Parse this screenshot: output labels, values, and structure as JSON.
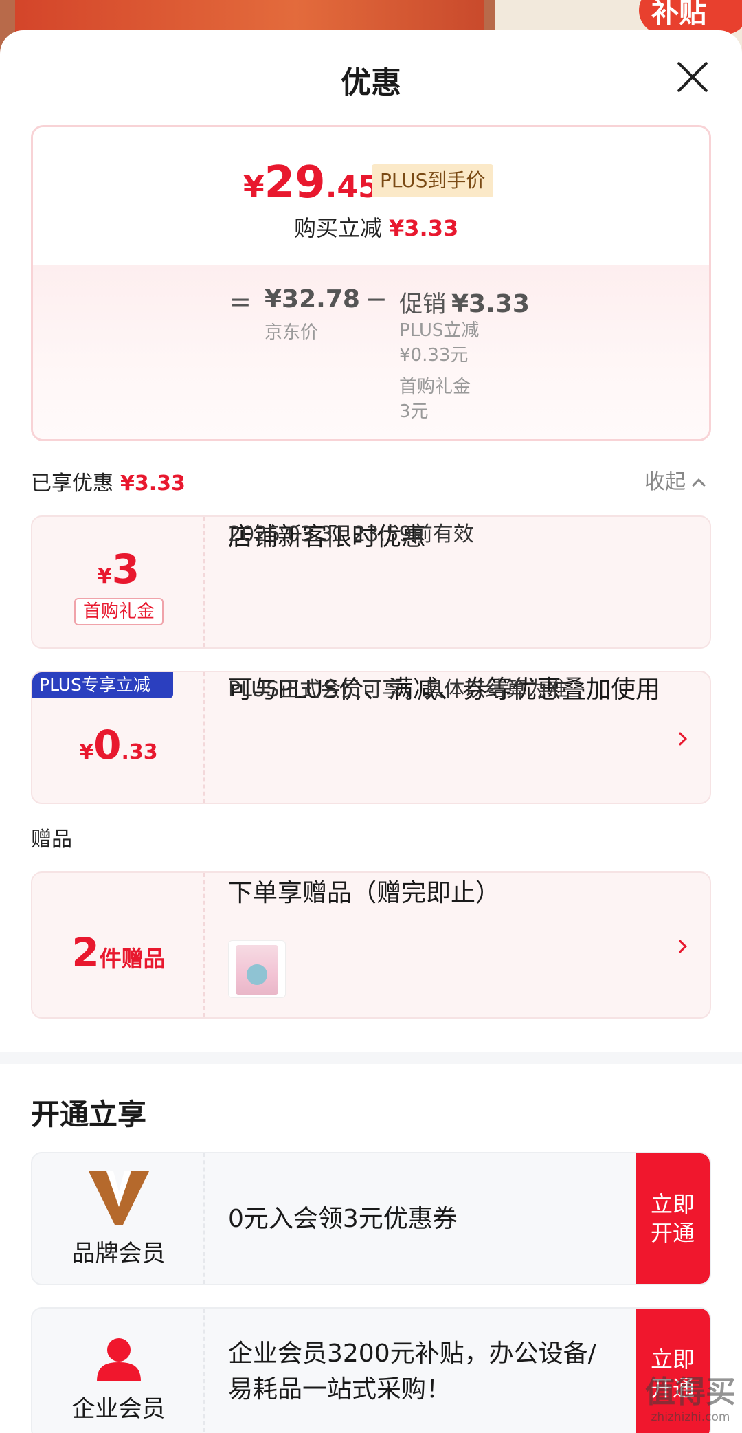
{
  "sheet": {
    "title": "优惠"
  },
  "price_card": {
    "final_symbol": "¥",
    "final_int": "29",
    "final_dec": ".45",
    "plus_tag": "PLUS到手价",
    "reduce_label": "购买立减",
    "reduce_amount": "¥3.33",
    "eq": "=",
    "jd_price": "¥32.78",
    "jd_label": "京东价",
    "minus": "−",
    "promo_label": "促销",
    "promo_amount": "¥3.33",
    "promo_items": [
      "PLUS立减",
      "¥0.33元",
      "首购礼金",
      "3元"
    ]
  },
  "enjoyed": {
    "label": "已享优惠",
    "amount": "¥3.33",
    "collapse": "收起"
  },
  "coupons": {
    "first": {
      "symbol": "¥",
      "amount": "3",
      "tag": "首购礼金",
      "title": "店铺新客限时优惠",
      "sub": "2025.03.31 23:59前有效"
    },
    "plus": {
      "badge": "PLUS专享立减",
      "symbol": "¥",
      "int": "0",
      "dec": ".33",
      "title": "可与PLUS价、满减、券等优惠叠加使用",
      "sub": "PLUS正式会员可享，具体以结算为准"
    }
  },
  "gifts": {
    "section_label": "赠品",
    "count": "2",
    "unit": "件赠品",
    "title": "下单享赠品（赠完即止）"
  },
  "open": {
    "title": "开通立享",
    "members": [
      {
        "label": "品牌会员",
        "text": "0元入会领3元优惠券",
        "button": "立即开通"
      },
      {
        "label": "企业会员",
        "text": "企业会员3200元补贴，办公设备/易耗品一站式采购！",
        "button": "立即开通"
      }
    ]
  },
  "watermark": {
    "big": "值得买",
    "small": "zhizhizhi.com"
  },
  "backdrop": {
    "badge": "补贴"
  },
  "colors": {
    "accent": "#e8182e",
    "plus_badge": "#2b3fbf",
    "button": "#f0172d"
  }
}
